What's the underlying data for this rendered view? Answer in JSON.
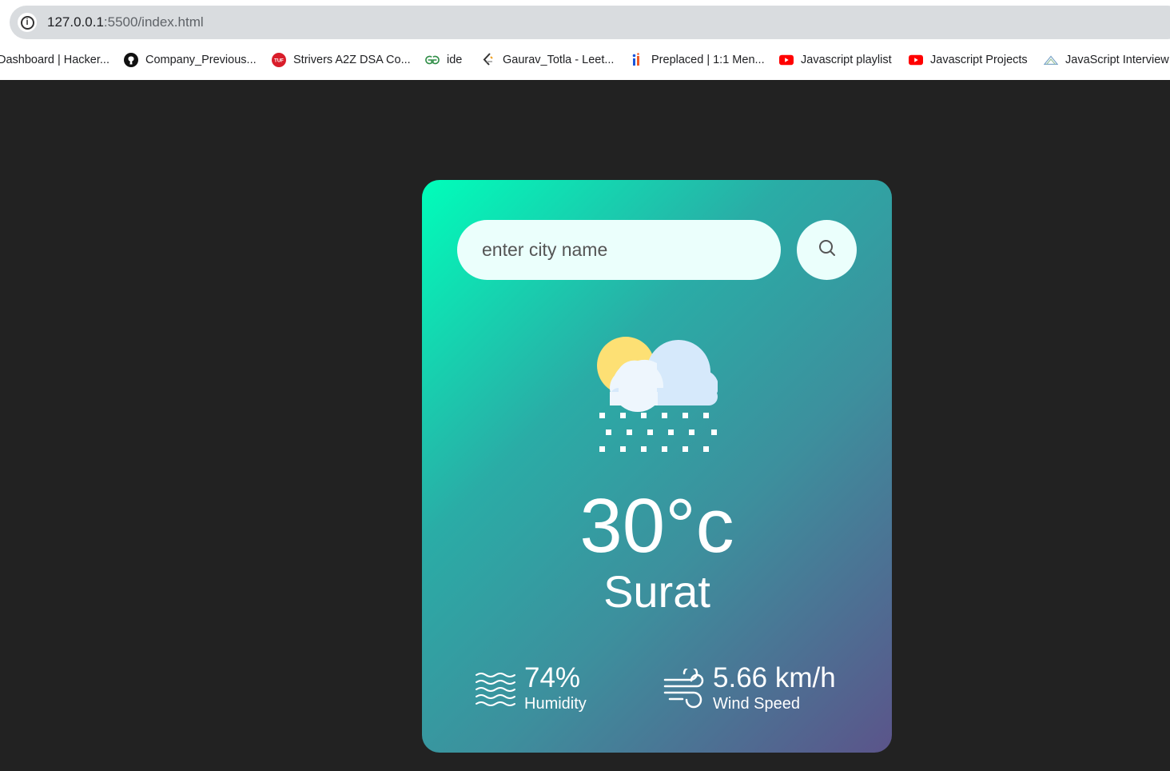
{
  "browser": {
    "url_host": "127.0.0.1",
    "url_path": ":5500/index.html",
    "bookmarks": [
      {
        "label": "Dashboard | Hacker...",
        "icon": "hackerrank-icon"
      },
      {
        "label": "Company_Previous...",
        "icon": "github-icon"
      },
      {
        "label": "Strivers A2Z DSA Co...",
        "icon": "tuf-icon"
      },
      {
        "label": "ide",
        "icon": "geeksforgeeks-icon"
      },
      {
        "label": "Gaurav_Totla - Leet...",
        "icon": "leetcode-icon"
      },
      {
        "label": "Preplaced | 1:1 Men...",
        "icon": "preplaced-icon"
      },
      {
        "label": "Javascript playlist",
        "icon": "youtube-icon"
      },
      {
        "label": "Javascript Projects",
        "icon": "youtube-icon"
      },
      {
        "label": "JavaScript Interview",
        "icon": "site-icon"
      }
    ]
  },
  "weather": {
    "search_placeholder": "enter city name",
    "condition_icon": "snow-cloud-sun-icon",
    "temperature": "30°c",
    "city": "Surat",
    "humidity_value": "74%",
    "humidity_label": "Humidity",
    "wind_value": "5.66 km/h",
    "wind_label": "Wind Speed"
  },
  "colors": {
    "page_bg": "#222222",
    "gradient_start": "#00feba",
    "gradient_end": "#5b548a",
    "input_bg": "#ebfffc"
  }
}
